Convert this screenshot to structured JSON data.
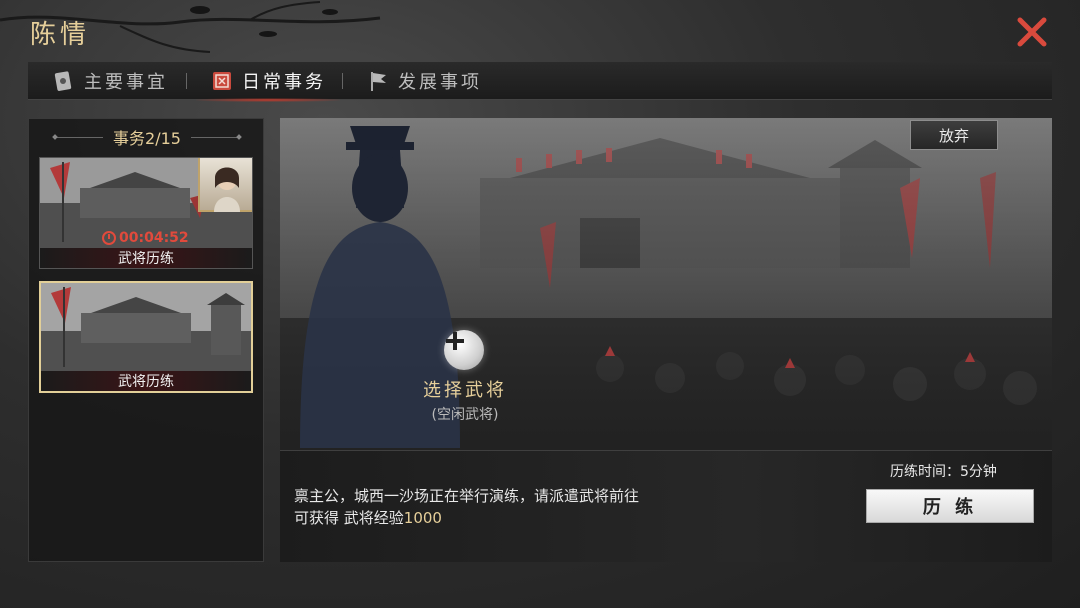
{
  "window": {
    "title": "陈情"
  },
  "tabs": [
    {
      "label": "主要事宜",
      "icon": "scroll-icon",
      "active": false
    },
    {
      "label": "日常事务",
      "icon": "seal-icon",
      "active": true
    },
    {
      "label": "发展事项",
      "icon": "flag-icon",
      "active": false
    }
  ],
  "affairs": {
    "header": "事务2/15",
    "cards": [
      {
        "label": "武将历练",
        "timer": "00:04:52",
        "has_portrait": true,
        "selected": false
      },
      {
        "label": "武将历练",
        "timer": "",
        "has_portrait": false,
        "selected": true
      }
    ]
  },
  "stage": {
    "abandon_label": "放弃",
    "select_general_label": "选择武将",
    "idle_general_label": "(空闲武将)"
  },
  "info": {
    "description_line1": "禀主公，城西一沙场正在举行演练，请派遣武将前往",
    "reward_prefix": "可获得 武将经验",
    "reward_value": "1000",
    "time_label": "历练时间：5分钟",
    "train_button_label": "历 练"
  },
  "colors": {
    "accent_gold": "#e6cf9a",
    "close_red": "#d94a3d",
    "timer_red": "#e14a3c",
    "tab_highlight": "#c0392b"
  }
}
